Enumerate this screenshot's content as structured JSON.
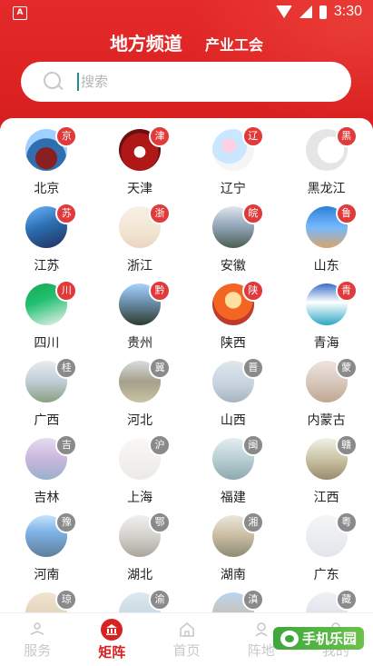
{
  "status": {
    "time": "3:30"
  },
  "header": {
    "title": "地方频道",
    "subtitle": "产业工会"
  },
  "search": {
    "placeholder": "搜索"
  },
  "cities": [
    {
      "name": "北京",
      "badge": "京",
      "badge_color": "#e03a3a",
      "img": "a"
    },
    {
      "name": "天津",
      "badge": "津",
      "badge_color": "#e03a3a",
      "img": "b"
    },
    {
      "name": "辽宁",
      "badge": "辽",
      "badge_color": "#e03a3a",
      "img": "c"
    },
    {
      "name": "黑龙江",
      "badge": "黑",
      "badge_color": "#e03a3a",
      "img": "d"
    },
    {
      "name": "江苏",
      "badge": "苏",
      "badge_color": "#e03a3a",
      "img": "e"
    },
    {
      "name": "浙江",
      "badge": "浙",
      "badge_color": "#e03a3a",
      "img": "f"
    },
    {
      "name": "安徽",
      "badge": "皖",
      "badge_color": "#e03a3a",
      "img": "g"
    },
    {
      "name": "山东",
      "badge": "鲁",
      "badge_color": "#e03a3a",
      "img": "h"
    },
    {
      "name": "四川",
      "badge": "川",
      "badge_color": "#e03a3a",
      "img": "i"
    },
    {
      "name": "贵州",
      "badge": "黔",
      "badge_color": "#e03a3a",
      "img": "j"
    },
    {
      "name": "陕西",
      "badge": "陕",
      "badge_color": "#e03a3a",
      "img": "k"
    },
    {
      "name": "青海",
      "badge": "青",
      "badge_color": "#e03a3a",
      "img": "l"
    },
    {
      "name": "广西",
      "badge": "桂",
      "badge_color": "#8a8a8a",
      "img": "m"
    },
    {
      "name": "河北",
      "badge": "冀",
      "badge_color": "#8a8a8a",
      "img": "n"
    },
    {
      "name": "山西",
      "badge": "晋",
      "badge_color": "#8a8a8a",
      "img": "o"
    },
    {
      "name": "内蒙古",
      "badge": "蒙",
      "badge_color": "#8a8a8a",
      "img": "p"
    },
    {
      "name": "吉林",
      "badge": "吉",
      "badge_color": "#8a8a8a",
      "img": "q"
    },
    {
      "name": "上海",
      "badge": "沪",
      "badge_color": "#8a8a8a",
      "img": "r"
    },
    {
      "name": "福建",
      "badge": "闽",
      "badge_color": "#8a8a8a",
      "img": "s"
    },
    {
      "name": "江西",
      "badge": "赣",
      "badge_color": "#8a8a8a",
      "img": "t"
    },
    {
      "name": "河南",
      "badge": "豫",
      "badge_color": "#8a8a8a",
      "img": "u"
    },
    {
      "name": "湖北",
      "badge": "鄂",
      "badge_color": "#8a8a8a",
      "img": "v"
    },
    {
      "name": "湖南",
      "badge": "湘",
      "badge_color": "#8a8a8a",
      "img": "w"
    },
    {
      "name": "广东",
      "badge": "粤",
      "badge_color": "#8a8a8a",
      "img": "x"
    },
    {
      "name": "",
      "badge": "琼",
      "badge_color": "#8a8a8a",
      "img": "y"
    },
    {
      "name": "",
      "badge": "渝",
      "badge_color": "#8a8a8a",
      "img": "z"
    },
    {
      "name": "",
      "badge": "滇",
      "badge_color": "#8a8a8a",
      "img": "aa"
    },
    {
      "name": "",
      "badge": "藏",
      "badge_color": "#8a8a8a",
      "img": "bb"
    }
  ],
  "nav": [
    {
      "label": "服务",
      "icon": "service-icon",
      "active": false
    },
    {
      "label": "矩阵",
      "icon": "matrix-icon",
      "active": true
    },
    {
      "label": "首页",
      "icon": "home-icon",
      "active": false
    },
    {
      "label": "阵地",
      "icon": "location-icon",
      "active": false
    },
    {
      "label": "我的",
      "icon": "profile-icon",
      "active": false
    }
  ],
  "watermark": {
    "text": "手机乐园"
  }
}
